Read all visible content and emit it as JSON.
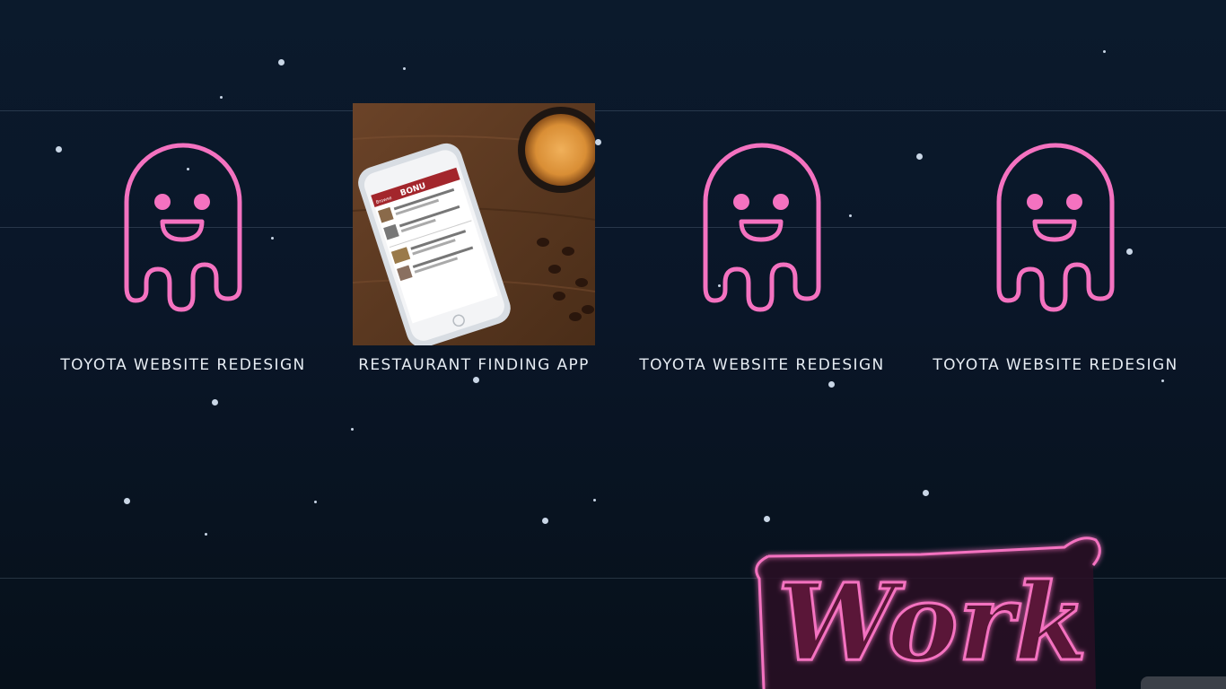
{
  "projects": [
    {
      "title": "TOYOTA WEBSITE REDESIGN",
      "thumbnail": "ghost-icon"
    },
    {
      "title": "RESTAURANT FINDING APP",
      "thumbnail": "phone-photo"
    },
    {
      "title": "TOYOTA WEBSITE REDESIGN",
      "thumbnail": "ghost-icon"
    },
    {
      "title": "TOYOTA WEBSITE REDESIGN",
      "thumbnail": "ghost-icon"
    }
  ],
  "neon_sign": {
    "text": "Work",
    "color": "#f472c0"
  },
  "phone_app": {
    "logo": "BONU",
    "header_label": "Browse"
  },
  "colors": {
    "background": "#0a1628",
    "accent": "#f472c0",
    "title_text": "#e6ecf3"
  }
}
